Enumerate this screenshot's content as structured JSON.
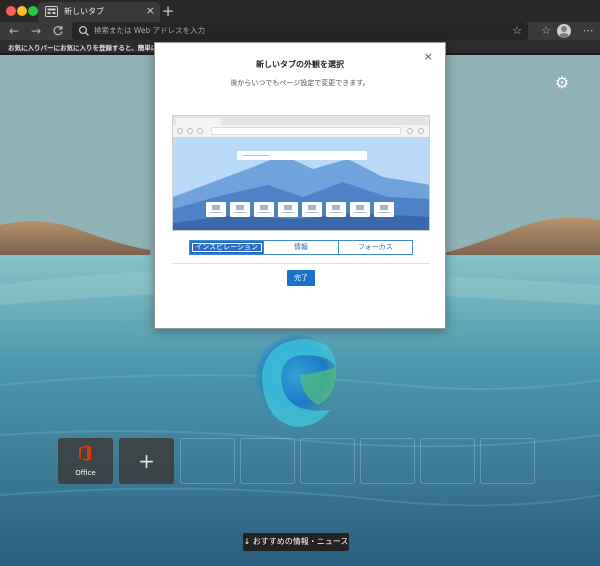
{
  "browser": {
    "tab_title": "新しいタブ",
    "tab_close": "×",
    "new_tab": "+",
    "address_placeholder": "検索または Web アドレスを入力",
    "favorites_message": "お気に入りバーにお気に入りを登録すると、簡単にアクセス"
  },
  "page": {
    "quick_links": [
      {
        "label": "Office",
        "icon": "office-icon"
      },
      {
        "label": "+",
        "icon": "add-icon"
      }
    ],
    "news_button": "↓ おすすめの情報・ニュース"
  },
  "modal": {
    "close": "×",
    "title": "新しいタブの外観を選択",
    "subtitle": "後からいつでもページ設定で変更できます。",
    "options": [
      "インスピレーション",
      "情報",
      "フォーカス"
    ],
    "selected_option": "インスピレーション",
    "done_label": "完了"
  },
  "colors": {
    "accent": "#1a73c8",
    "office_brand": "#d83b01"
  }
}
